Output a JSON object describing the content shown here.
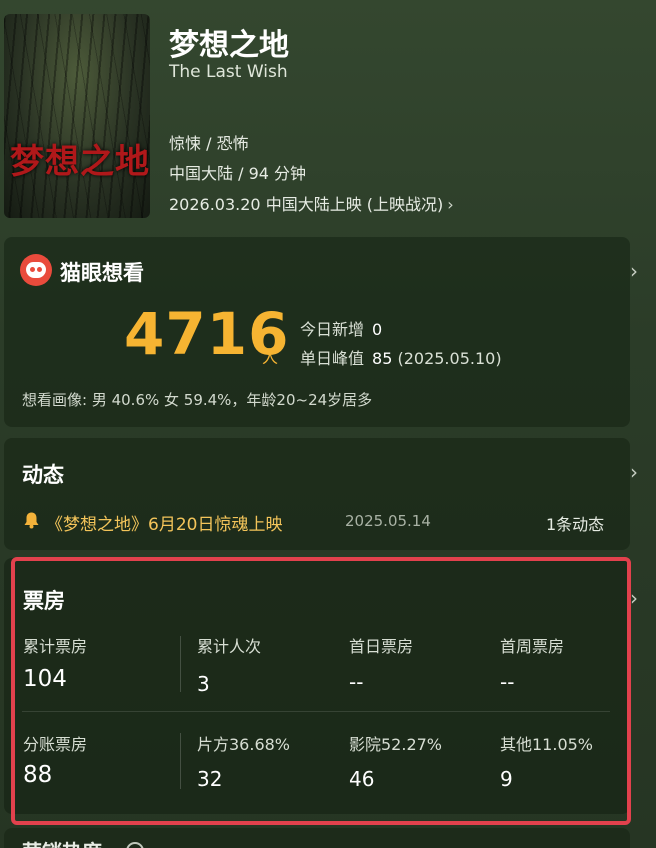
{
  "movie": {
    "title": "梦想之地",
    "english_title": "The Last Wish",
    "genre": "惊悚 / 恐怖",
    "region_duration": "中国大陆 / 94 分钟",
    "release": "2026.03.20 中国大陆上映 (上映战况)",
    "poster": {
      "title_text": "梦想之地"
    }
  },
  "want": {
    "label": "猫眼想看",
    "count": "4716",
    "unit": "人",
    "today_label": "今日新增",
    "today_value": "0",
    "peak_label": "单日峰值",
    "peak_value": "85",
    "peak_date": "(2025.05.10)",
    "portrait": "想看画像: 男 40.6%   女 59.4%，年龄20~24岁居多"
  },
  "dynamics": {
    "title": "动态",
    "item_text": "《梦想之地》6月20日惊魂上映",
    "item_date": "2025.05.14",
    "count": "1条动态"
  },
  "box_office": {
    "title": "票房",
    "row1": [
      {
        "label": "累计票房",
        "value": "104"
      },
      {
        "label": "累计人次",
        "value": "3"
      },
      {
        "label": "首日票房",
        "value": "--"
      },
      {
        "label": "首周票房",
        "value": "--"
      }
    ],
    "row2": [
      {
        "label": "分账票房",
        "value": "88"
      },
      {
        "label": "片方36.68%",
        "value": "32"
      },
      {
        "label": "影院52.27%",
        "value": "46"
      },
      {
        "label": "其他11.05%",
        "value": "9"
      }
    ]
  },
  "next_section": {
    "title": "营销热度"
  },
  "colors": {
    "accent": "#f6b432",
    "highlight_border": "#e2414d",
    "maoyan_red": "#e94b3c",
    "dynamic_text": "#f3c45a"
  }
}
